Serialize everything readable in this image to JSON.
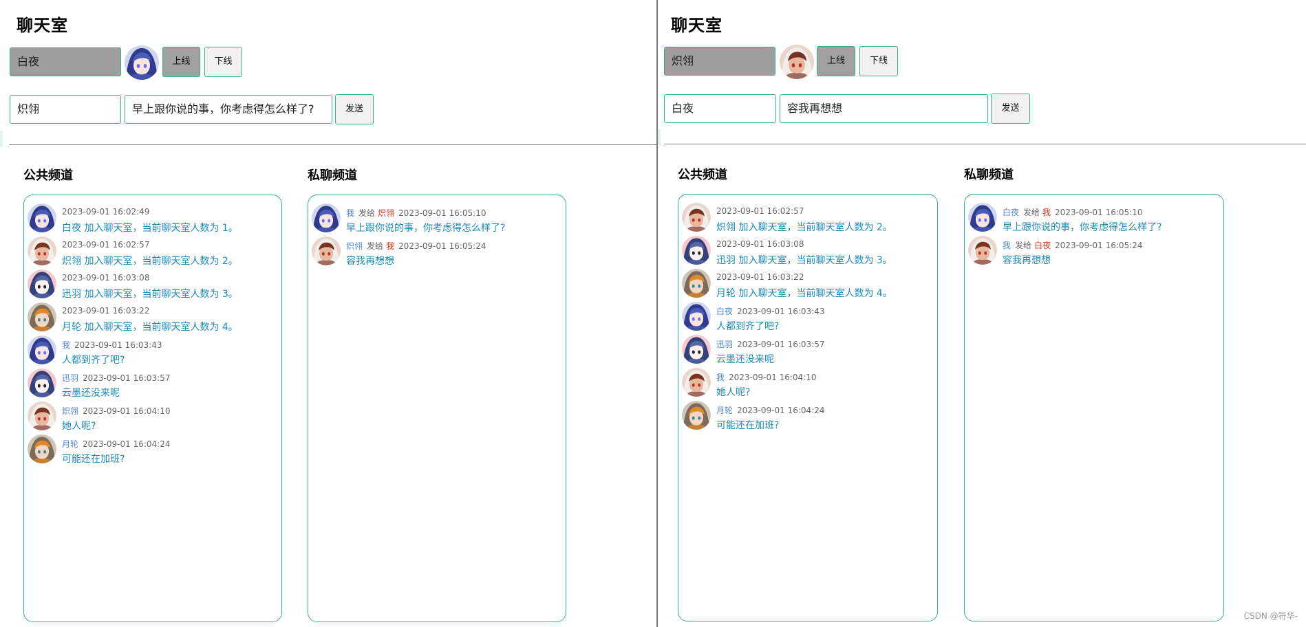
{
  "colors": {
    "accent_border": "#36b48a",
    "message_text": "#1b8bb8",
    "sender_name": "#4f86d6",
    "private_target": "#e0341c",
    "disabled_gray": "#9e9e9e"
  },
  "panels": [
    {
      "title": "聊天室",
      "username": "白夜",
      "user_avatar": "blue",
      "online_label": "上线",
      "offline_label": "下线",
      "recipient": "炽翎",
      "message_draft": "早上跟你说的事，你考虑得怎么样了?",
      "send_label": "发送",
      "public_title": "公共频道",
      "private_title": "私聊频道",
      "public_messages": [
        {
          "avatar": "blue",
          "name": "",
          "time": "2023-09-01 16:02:49",
          "text": "白夜 加入聊天室，当前聊天室人数为 1。"
        },
        {
          "avatar": "red",
          "name": "",
          "time": "2023-09-01 16:02:57",
          "text": "炽翎 加入聊天室，当前聊天室人数为 2。"
        },
        {
          "avatar": "pink",
          "name": "",
          "time": "2023-09-01 16:03:08",
          "text": "迅羽 加入聊天室，当前聊天室人数为 3。"
        },
        {
          "avatar": "teal",
          "name": "",
          "time": "2023-09-01 16:03:22",
          "text": "月轮 加入聊天室，当前聊天室人数为 4。"
        },
        {
          "avatar": "blue",
          "name": "我",
          "time": "2023-09-01 16:03:43",
          "text": "人都到齐了吧?"
        },
        {
          "avatar": "pink",
          "name": "迅羽",
          "time": "2023-09-01 16:03:57",
          "text": "云墨还没来呢"
        },
        {
          "avatar": "red",
          "name": "炽翎",
          "time": "2023-09-01 16:04:10",
          "text": "她人呢?"
        },
        {
          "avatar": "teal",
          "name": "月轮",
          "time": "2023-09-01 16:04:24",
          "text": "可能还在加班?"
        }
      ],
      "private_messages": [
        {
          "avatar": "blue",
          "from": "我",
          "to_label": "发给",
          "to": "炽翎",
          "time": "2023-09-01 16:05:10",
          "text": "早上跟你说的事，你考虑得怎么样了?"
        },
        {
          "avatar": "red",
          "from": "炽翎",
          "to_label": "发给",
          "to": "我",
          "time": "2023-09-01 16:05:24",
          "text": "容我再想想"
        }
      ]
    },
    {
      "title": "聊天室",
      "username": "炽翎",
      "user_avatar": "red",
      "online_label": "上线",
      "offline_label": "下线",
      "recipient": "白夜",
      "message_draft": "容我再想想",
      "send_label": "发送",
      "public_title": "公共频道",
      "private_title": "私聊频道",
      "public_messages": [
        {
          "avatar": "red",
          "name": "",
          "time": "2023-09-01 16:02:57",
          "text": "炽翎 加入聊天室，当前聊天室人数为 2。"
        },
        {
          "avatar": "pink",
          "name": "",
          "time": "2023-09-01 16:03:08",
          "text": "迅羽 加入聊天室，当前聊天室人数为 3。"
        },
        {
          "avatar": "teal",
          "name": "",
          "time": "2023-09-01 16:03:22",
          "text": "月轮 加入聊天室，当前聊天室人数为 4。"
        },
        {
          "avatar": "blue",
          "name": "白夜",
          "time": "2023-09-01 16:03:43",
          "text": "人都到齐了吧?"
        },
        {
          "avatar": "pink",
          "name": "迅羽",
          "time": "2023-09-01 16:03:57",
          "text": "云墨还没来呢"
        },
        {
          "avatar": "red",
          "name": "我",
          "time": "2023-09-01 16:04:10",
          "text": "她人呢?"
        },
        {
          "avatar": "teal",
          "name": "月轮",
          "time": "2023-09-01 16:04:24",
          "text": "可能还在加班?"
        }
      ],
      "private_messages": [
        {
          "avatar": "blue",
          "from": "白夜",
          "to_label": "发给",
          "to": "我",
          "time": "2023-09-01 16:05:10",
          "text": "早上跟你说的事，你考虑得怎么样了?"
        },
        {
          "avatar": "red",
          "from": "我",
          "to_label": "发给",
          "to": "白夜",
          "time": "2023-09-01 16:05:24",
          "text": "容我再想想"
        }
      ]
    }
  ],
  "watermark": "CSDN @符华-"
}
